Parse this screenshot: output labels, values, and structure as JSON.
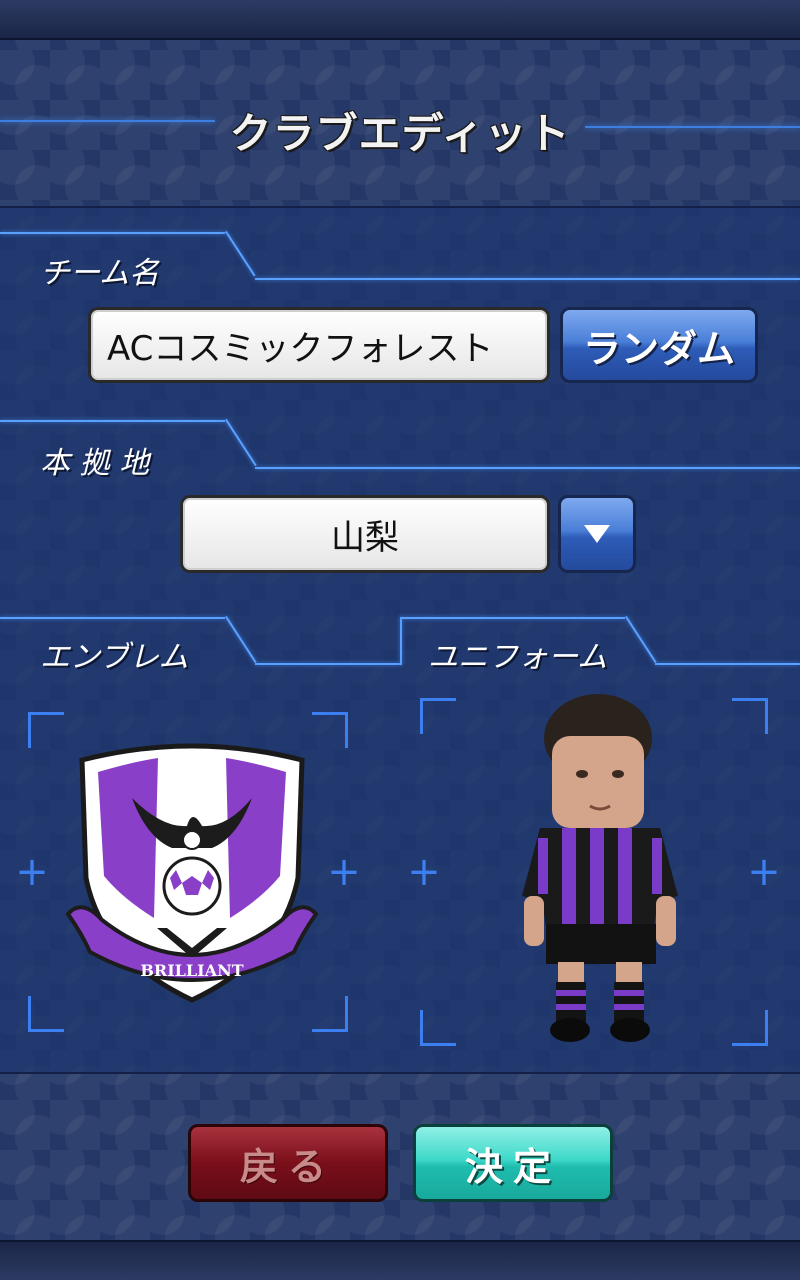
{
  "header": {
    "title": "クラブエディット"
  },
  "team_name": {
    "label": "チーム名",
    "value": "ACコスミックフォレスト",
    "random_button": "ランダム"
  },
  "home_town": {
    "label": "本 拠 地",
    "value": "山梨"
  },
  "emblem": {
    "label": "エンブレム",
    "banner_text": "BRILLIANT"
  },
  "uniform": {
    "label": "ユニフォーム"
  },
  "footer": {
    "back_button": "戻る",
    "confirm_button": "決定"
  },
  "colors": {
    "accent_blue": "#3b7ff0",
    "emblem_purple": "#8a3fc9",
    "back_button_red": "#7a0f1a",
    "confirm_button_teal": "#24d0c0"
  }
}
